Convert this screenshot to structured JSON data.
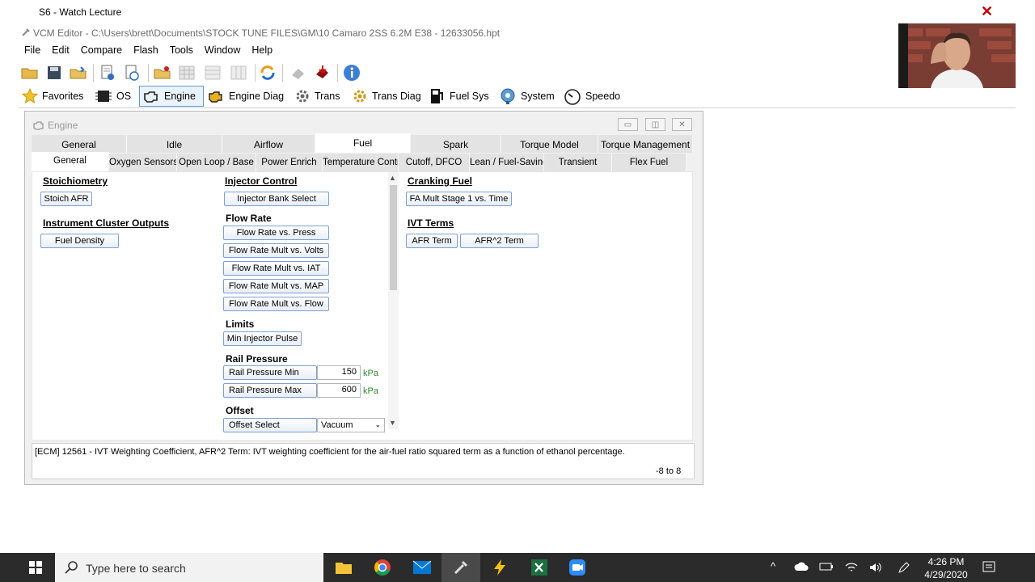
{
  "outer": {
    "title": "S6 - Watch Lecture"
  },
  "vcm": {
    "title": "VCM Editor - C:\\Users\\brett\\Documents\\STOCK TUNE FILES\\GM\\10 Camaro 2SS 6.2M E38 - 12633056.hpt",
    "menu": [
      "File",
      "Edit",
      "Compare",
      "Flash",
      "Tools",
      "Window",
      "Help"
    ],
    "toolbar2": [
      "Favorites",
      "OS",
      "Engine",
      "Engine Diag",
      "Trans",
      "Trans Diag",
      "Fuel Sys",
      "System",
      "Speedo"
    ]
  },
  "engine": {
    "title": "Engine",
    "tabs1": [
      "General",
      "Idle",
      "Airflow",
      "Fuel",
      "Spark",
      "Torque Model",
      "Torque Management"
    ],
    "tabs2": [
      "General",
      "Oxygen Sensors",
      "Open Loop / Base",
      "Power Enrich",
      "Temperature Contr",
      "Cutoff, DFCO",
      "Lean / Fuel-Saving",
      "Transient",
      "Flex Fuel"
    ],
    "left": {
      "stoich_header": "Stoichiometry",
      "stoich_btn": "Stoich AFR",
      "cluster_header": "Instrument Cluster Outputs",
      "cluster_btn": "Fuel Density"
    },
    "middle": {
      "injector_header": "Injector Control",
      "injector_btn": "Injector Bank Select",
      "flow_header": "Flow Rate",
      "flow_btns": [
        "Flow Rate vs. Press",
        "Flow Rate Mult vs. Volts",
        "Flow Rate Mult vs. IAT",
        "Flow Rate Mult vs. MAP",
        "Flow Rate Mult vs. Flow"
      ],
      "limits_header": "Limits",
      "limits_btn": "Min Injector Pulse",
      "rail_header": "Rail Pressure",
      "rail_min_label": "Rail Pressure Min",
      "rail_min_value": "150",
      "rail_max_label": "Rail Pressure Max",
      "rail_max_value": "600",
      "unit": "kPa",
      "offset_header": "Offset",
      "offset_label": "Offset Select",
      "offset_value": "Vacuum"
    },
    "right": {
      "cranking_header": "Cranking Fuel",
      "cranking_btn": "FA Mult Stage 1 vs. Time",
      "ivt_header": "IVT Terms",
      "ivt_btn1": "AFR Term",
      "ivt_btn2": "AFR^2 Term"
    },
    "info_text": "[ECM] 12561 - IVT Weighting Coefficient, AFR^2 Term: IVT weighting coefficient for the air-fuel ratio squared term as a function of ethanol percentage.",
    "info_range": "-8 to 8"
  },
  "taskbar": {
    "search_placeholder": "Type here to search",
    "time": "4:26 PM",
    "date": "4/29/2020"
  }
}
